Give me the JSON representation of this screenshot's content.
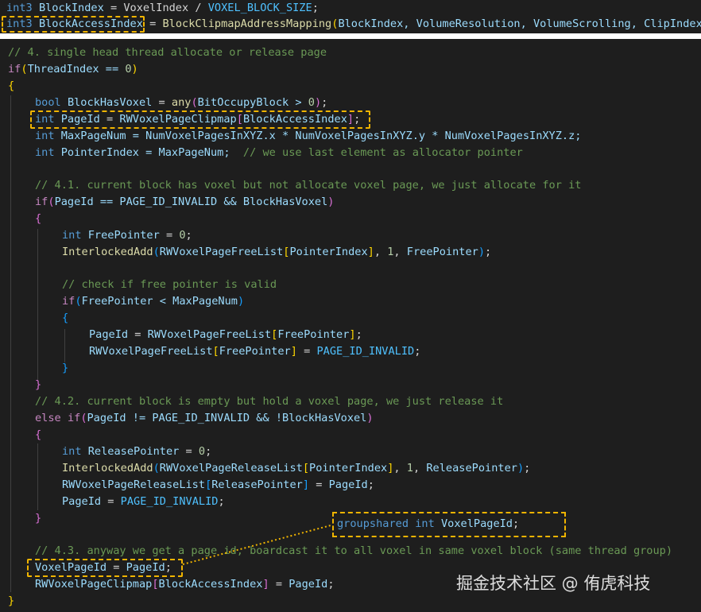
{
  "header_lines": {
    "line1": {
      "type": "int3",
      "name": "BlockIndex",
      "rest": " = VoxelIndex / ",
      "macro": "VOXEL_BLOCK_SIZE",
      "end": ";"
    },
    "line2": {
      "type": "int3",
      "name": "BlockAccessIndex",
      "eq": " = ",
      "fn": "BlockClipmapAddressMapping",
      "open": "(",
      "args": "BlockIndex, VolumeResolution, VolumeScrolling, ClipIndex",
      "close": ")",
      "end": ";"
    }
  },
  "code": {
    "c4": "// 4. single head thread allocate or release page",
    "if_kw": "if",
    "if_cond": "ThreadIndex == ",
    "zero": "0",
    "open_brace": "{",
    "close_brace": "}",
    "bool_kw": "bool",
    "block_has_voxel": "BlockHasVoxel",
    "any_fn": "any",
    "bit_occupy": "BitOccupyBlock > ",
    "int_kw": "int",
    "page_id": "PageId",
    "rw_clipmap": "RWVoxelPageClipmap",
    "block_access_index": "BlockAccessIndex",
    "max_page_num_decl": "MaxPageNum = NumVoxelPagesInXYZ.x * NumVoxelPagesInXYZ.y * NumVoxelPagesInXYZ.z;",
    "pointer_index_decl": "PointerIndex = MaxPageNum;",
    "c_pointer": "// we use last element as allocator pointer",
    "c41": "// 4.1. current block has voxel but not allocate voxel page, we just allocate for it",
    "if41_cond": "PageId == PAGE_ID_INVALID && BlockHasVoxel",
    "free_pointer": "FreePointer",
    "interlocked_add": "InterlockedAdd",
    "rw_free_list": "RWVoxelPageFreeList",
    "pointer_index": "PointerIndex",
    "one": "1",
    "c_check": "// check if free pointer is valid",
    "if_free_cond": "FreePointer < MaxPageNum",
    "page_id_invalid": "PAGE_ID_INVALID",
    "c42": "// 4.2. current block is empty but hold a voxel page, we just release it",
    "else_kw": "else",
    "if42_cond": "PageId != PAGE_ID_INVALID && !BlockHasVoxel",
    "release_pointer": "ReleasePointer",
    "rw_release_list": "RWVoxelPageReleaseList",
    "c43": "// 4.3. anyway we get a page id, boardcast it to all voxel in same voxel block (same thread group)",
    "voxel_page_id": "VoxelPageId"
  },
  "callout": {
    "groupshared": "groupshared",
    "int": "int",
    "name": "VoxelPageId",
    "end": ";"
  },
  "watermark": "掘金技术社区 @ 侑虎科技",
  "colors": {
    "highlight_box": "#f0b400",
    "background": "#1e1e1e",
    "keyword": "#569cd6",
    "comment": "#6a9955",
    "function": "#dcdcaa",
    "variable": "#9cdcfe"
  }
}
